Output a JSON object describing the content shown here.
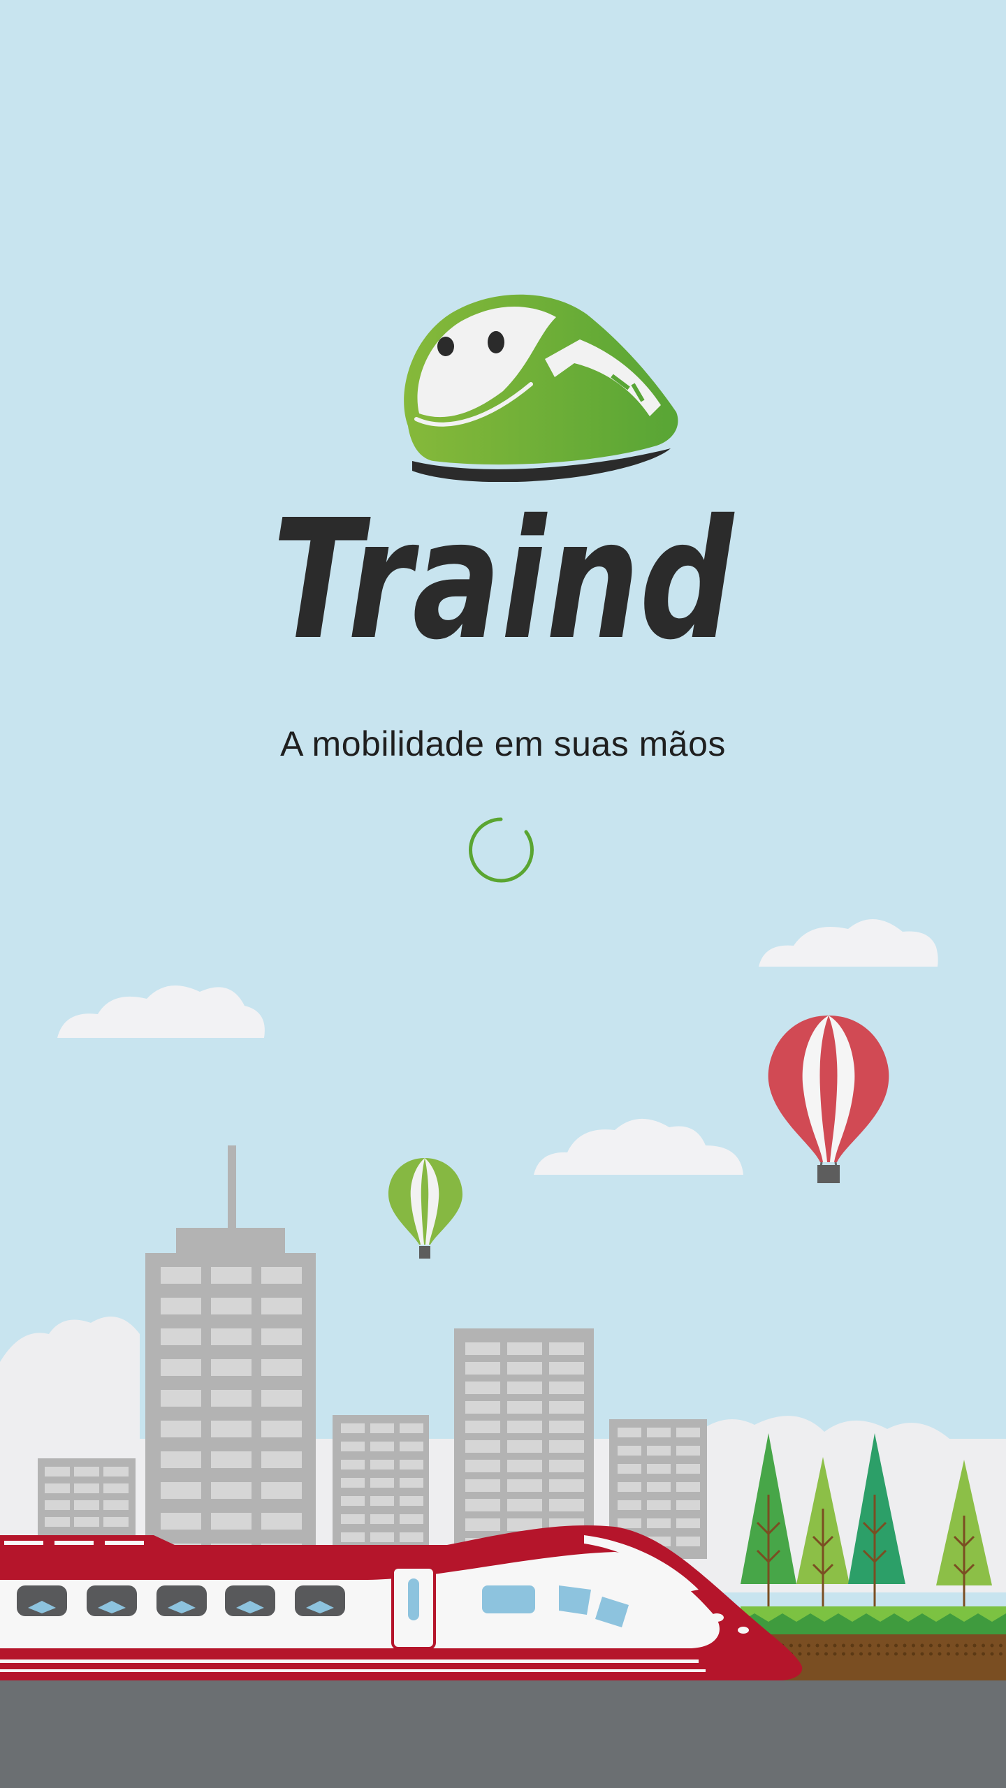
{
  "app": {
    "name": "Traind",
    "tagline": "A mobilidade em suas mãos"
  },
  "loading": {
    "indicator": "spinner",
    "color": "#5aa531"
  },
  "colors": {
    "sky": "#c8e4ef",
    "brand_green": "#6fb33a",
    "wordmark": "#2b2b2b",
    "train_red": "#b5152b",
    "ground": "#6b6f72",
    "soil": "#7a4e22",
    "building_gray": "#b3b3b3"
  },
  "icons": {
    "mascot": "smiling-train-head",
    "balloons": [
      "red-striped-balloon",
      "green-striped-balloon"
    ],
    "train": "high-speed-train"
  }
}
